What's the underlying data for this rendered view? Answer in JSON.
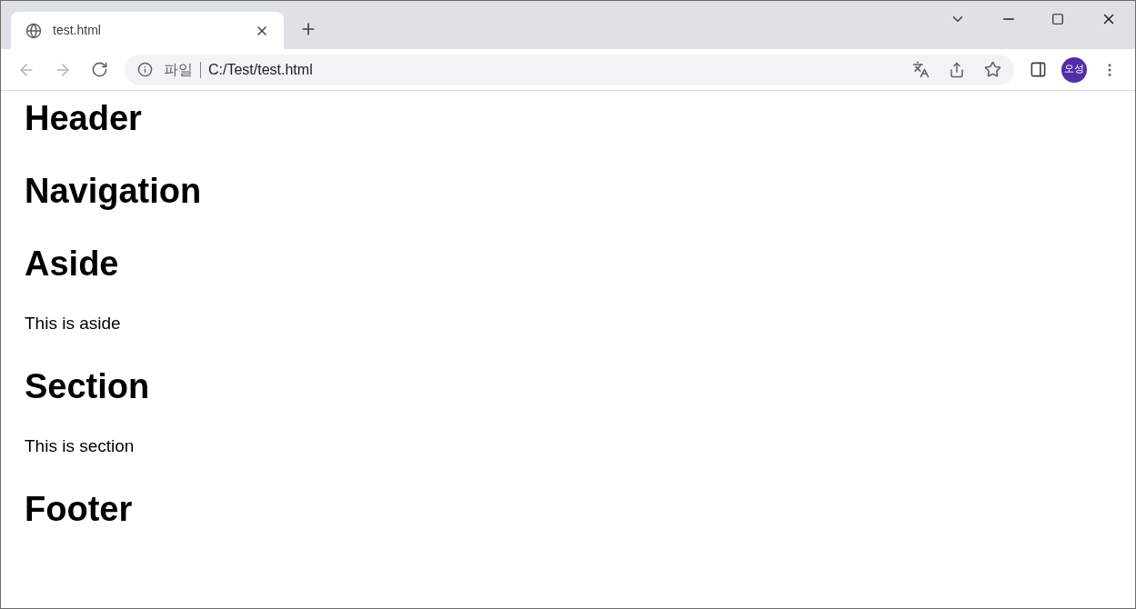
{
  "tab": {
    "title": "test.html",
    "selected": true
  },
  "nav": {
    "back_disabled": true,
    "forward_disabled": true
  },
  "address": {
    "scheme_label": "파일",
    "url": "C:/Test/test.html"
  },
  "profile": {
    "initials": "오성"
  },
  "content": [
    {
      "kind": "heading",
      "text": "Header"
    },
    {
      "kind": "heading",
      "text": "Navigation"
    },
    {
      "kind": "heading",
      "text": "Aside"
    },
    {
      "kind": "paragraph",
      "text": "This is aside"
    },
    {
      "kind": "heading",
      "text": "Section"
    },
    {
      "kind": "paragraph",
      "text": "This is section"
    },
    {
      "kind": "heading",
      "text": "Footer"
    }
  ]
}
